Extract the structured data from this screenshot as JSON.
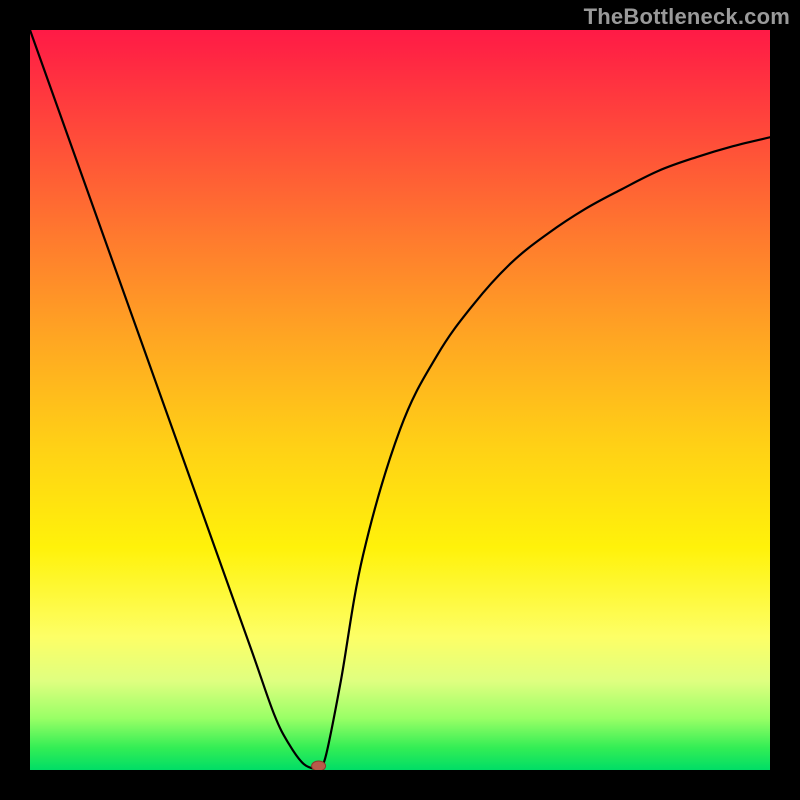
{
  "watermark": "TheBottleneck.com",
  "chart_data": {
    "type": "line",
    "title": "",
    "xlabel": "",
    "ylabel": "",
    "xlim": [
      0,
      1
    ],
    "ylim": [
      0,
      1
    ],
    "grid": false,
    "legend": false,
    "series": [
      {
        "name": "curve",
        "x": [
          0.0,
          0.05,
          0.1,
          0.15,
          0.2,
          0.25,
          0.3,
          0.33,
          0.35,
          0.37,
          0.39,
          0.4,
          0.42,
          0.45,
          0.5,
          0.55,
          0.6,
          0.65,
          0.7,
          0.75,
          0.8,
          0.85,
          0.9,
          0.95,
          1.0
        ],
        "y": [
          1.0,
          0.86,
          0.72,
          0.58,
          0.44,
          0.3,
          0.16,
          0.075,
          0.035,
          0.008,
          0.0,
          0.02,
          0.12,
          0.29,
          0.46,
          0.56,
          0.63,
          0.685,
          0.725,
          0.758,
          0.785,
          0.81,
          0.828,
          0.843,
          0.855
        ]
      }
    ],
    "min_point": {
      "x": 0.39,
      "y": 0.0
    },
    "background_gradient_stops": [
      {
        "pos": 0.0,
        "color": "#ff1a46"
      },
      {
        "pos": 0.14,
        "color": "#ff4a3a"
      },
      {
        "pos": 0.28,
        "color": "#ff7a2e"
      },
      {
        "pos": 0.42,
        "color": "#ffa722"
      },
      {
        "pos": 0.56,
        "color": "#ffd016"
      },
      {
        "pos": 0.7,
        "color": "#fff20a"
      },
      {
        "pos": 0.82,
        "color": "#fdff66"
      },
      {
        "pos": 0.88,
        "color": "#dfff80"
      },
      {
        "pos": 0.93,
        "color": "#99ff66"
      },
      {
        "pos": 0.97,
        "color": "#33ee55"
      },
      {
        "pos": 1.0,
        "color": "#00dd66"
      }
    ]
  }
}
